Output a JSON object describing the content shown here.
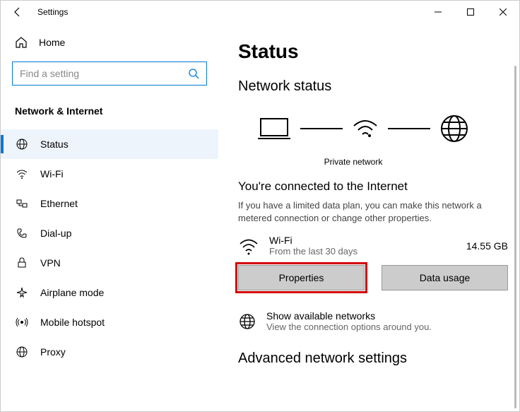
{
  "window": {
    "title": "Settings"
  },
  "sidebar": {
    "home": "Home",
    "search_placeholder": "Find a setting",
    "section": "Network & Internet",
    "items": [
      {
        "label": "Status"
      },
      {
        "label": "Wi-Fi"
      },
      {
        "label": "Ethernet"
      },
      {
        "label": "Dial-up"
      },
      {
        "label": "VPN"
      },
      {
        "label": "Airplane mode"
      },
      {
        "label": "Mobile hotspot"
      },
      {
        "label": "Proxy"
      }
    ]
  },
  "main": {
    "page_title": "Status",
    "network_status_heading": "Network status",
    "diagram_label": "Private network",
    "connected_title": "You're connected to the Internet",
    "connected_desc": "If you have a limited data plan, you can make this network a metered connection or change other properties.",
    "wifi_name": "Wi-Fi",
    "wifi_sub": "From the last 30 days",
    "wifi_usage": "14.55 GB",
    "properties_btn": "Properties",
    "data_usage_btn": "Data usage",
    "available_title": "Show available networks",
    "available_sub": "View the connection options around you.",
    "advanced_heading": "Advanced network settings"
  }
}
